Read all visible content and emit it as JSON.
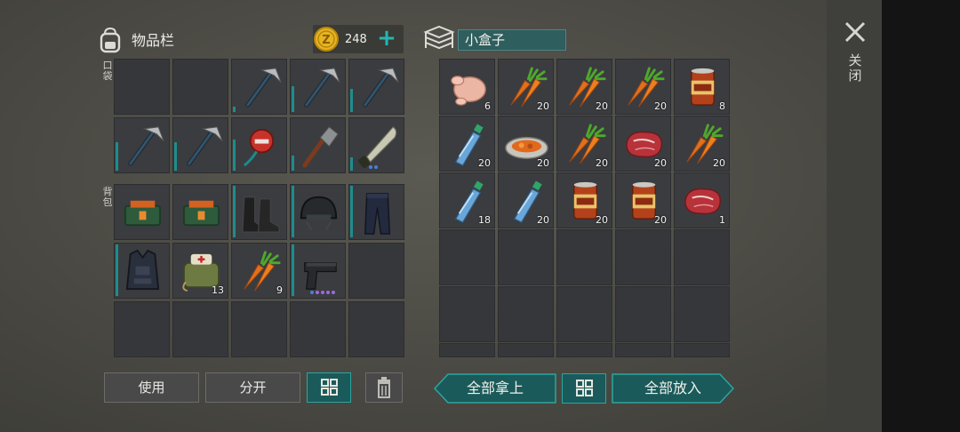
{
  "inventory": {
    "title": "物品栏",
    "coins": "248",
    "pocket_label": "口袋",
    "backpack_label": "背包"
  },
  "container": {
    "title": "小盒子"
  },
  "close_label": "关闭",
  "buttons": {
    "use": "使用",
    "split": "分开",
    "take_all": "全部拿上",
    "put_all": "全部放入"
  },
  "pocket_slots": [
    {
      "item": "empty"
    },
    {
      "item": "empty"
    },
    {
      "item": "hatchet",
      "durability": 0.1
    },
    {
      "item": "hatchet",
      "durability": 0.5
    },
    {
      "item": "hatchet",
      "durability": 0.45
    },
    {
      "item": "hatchet",
      "durability": 0.55
    },
    {
      "item": "hatchet",
      "durability": 0.55
    },
    {
      "item": "sledgehammer",
      "durability": 0.6
    },
    {
      "item": "shovel",
      "durability": 0.3
    },
    {
      "item": "machete",
      "durability": 0.25,
      "dots": 2
    }
  ],
  "backpack_slots": [
    {
      "item": "medkit-box",
      "durability": 0
    },
    {
      "item": "medkit-box",
      "durability": 0
    },
    {
      "item": "boots",
      "durability": 1.0
    },
    {
      "item": "helmet",
      "durability": 1.0
    },
    {
      "item": "pants",
      "durability": 1.0
    },
    {
      "item": "armor-vest",
      "durability": 1.0
    },
    {
      "item": "first-aid-bag",
      "count": "13"
    },
    {
      "item": "carrot",
      "count": "9"
    },
    {
      "item": "pistol",
      "durability": 1.0,
      "dots": 5
    },
    {
      "item": "empty"
    },
    {
      "item": "empty"
    },
    {
      "item": "empty"
    },
    {
      "item": "empty"
    },
    {
      "item": "empty"
    },
    {
      "item": "empty"
    }
  ],
  "box_slots": [
    {
      "item": "raw-chicken",
      "count": "6"
    },
    {
      "item": "carrot",
      "count": "20"
    },
    {
      "item": "carrot",
      "count": "20"
    },
    {
      "item": "carrot",
      "count": "20"
    },
    {
      "item": "canned-food",
      "count": "8"
    },
    {
      "item": "water-bottle",
      "count": "20"
    },
    {
      "item": "vegetable-stew",
      "count": "20"
    },
    {
      "item": "carrot",
      "count": "20"
    },
    {
      "item": "raw-meat",
      "count": "20"
    },
    {
      "item": "carrot",
      "count": "20"
    },
    {
      "item": "water-bottle",
      "count": "18"
    },
    {
      "item": "water-bottle",
      "count": "20"
    },
    {
      "item": "canned-food",
      "count": "20"
    },
    {
      "item": "canned-food",
      "count": "20"
    },
    {
      "item": "raw-meat",
      "count": "1"
    },
    {
      "item": "empty"
    },
    {
      "item": "empty"
    },
    {
      "item": "empty"
    },
    {
      "item": "empty"
    },
    {
      "item": "empty"
    },
    {
      "item": "empty"
    },
    {
      "item": "empty"
    },
    {
      "item": "empty"
    },
    {
      "item": "empty"
    },
    {
      "item": "empty"
    },
    {
      "item": "empty"
    },
    {
      "item": "empty"
    },
    {
      "item": "empty"
    },
    {
      "item": "empty"
    },
    {
      "item": "empty"
    }
  ],
  "colors": {
    "accent": "#25b5b0",
    "slot_bg": "#36373a",
    "durability": "#1f8c8c",
    "dot_blue": "#4a7fd8",
    "dot_purple": "#9d6ad8"
  }
}
